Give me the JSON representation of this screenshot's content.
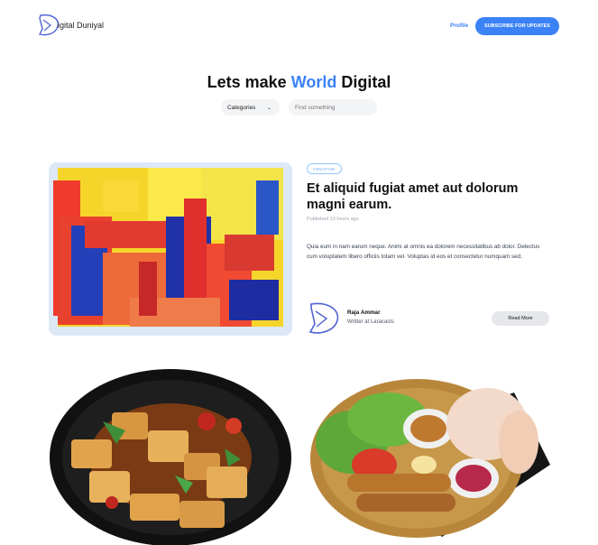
{
  "header": {
    "logo_text": "igital Duniyal",
    "nav": {
      "profile": "Profile"
    },
    "subscribe_label": "SUBSCRIBE FOR UPDATES"
  },
  "hero": {
    "title_prefix": "Lets make ",
    "title_accent": "World",
    "title_suffix": " Digital",
    "category_label": "Categories",
    "search_placeholder": "Find something"
  },
  "featured_post": {
    "badge": "CREATIVE",
    "title": "Et aliquid fugiat amet aut dolorum magni earum.",
    "meta": "Published 13 hours ago",
    "excerpt": "Quia eum in nam earum neque. Animi at omnis ea dolorem necessitatibus ab dolor. Delectus cum voluptatem libero officiis totam vel. Voluptas id eos et consectetur numquam sed.",
    "author_name": "Raja Ammar",
    "author_role": "Writter at Laracasts",
    "read_more": "Read More"
  },
  "colors": {
    "accent": "#3b82f6",
    "button_gray": "#e5e7eb",
    "input_bg": "#f3f4f6"
  }
}
